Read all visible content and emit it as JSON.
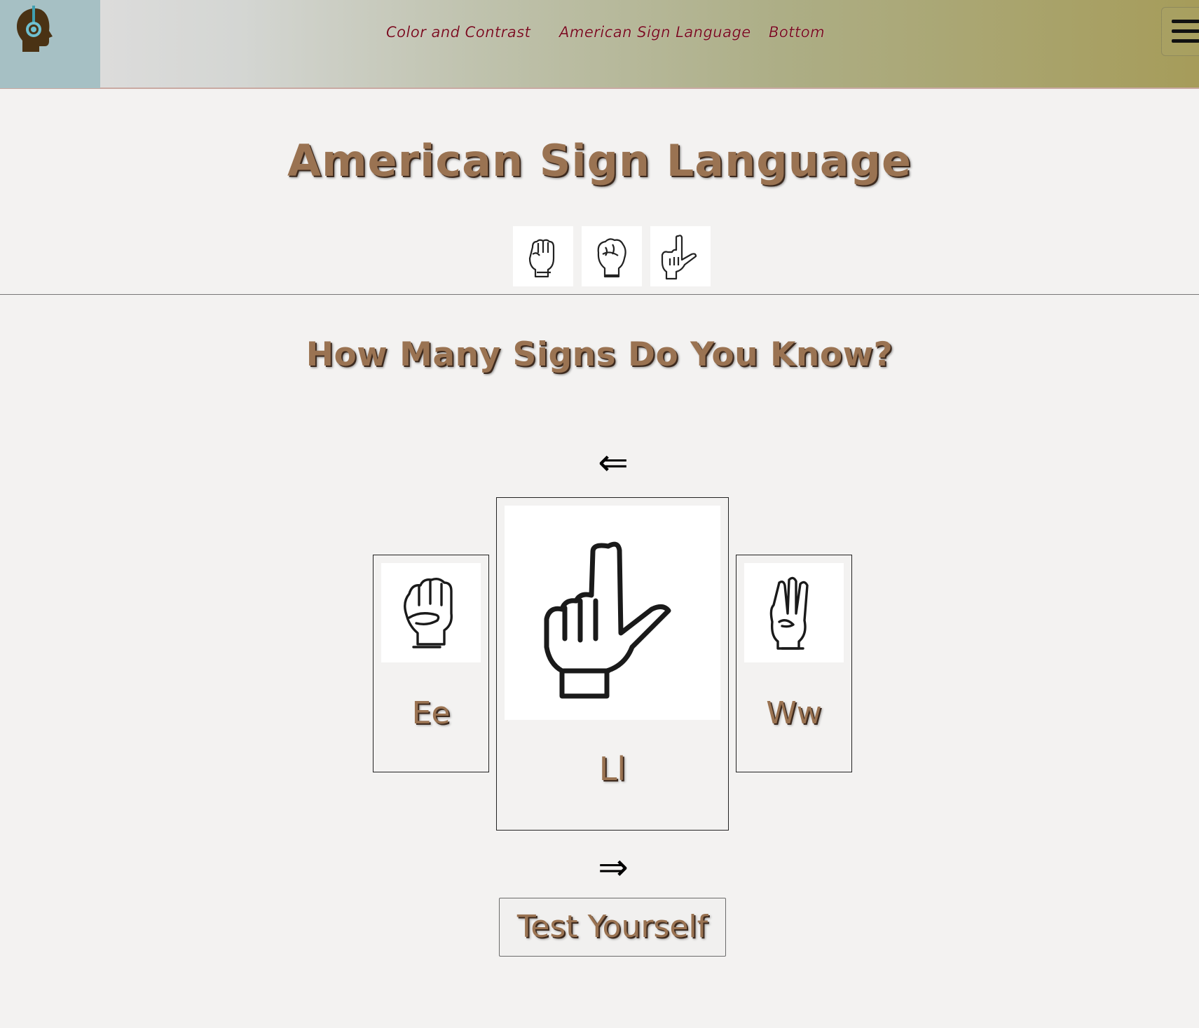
{
  "header": {
    "logo_icon": "head-headphones-icon",
    "nav": {
      "color_contrast": "Color and Contrast",
      "asl": "American Sign Language",
      "bottom": "Bottom"
    },
    "menu_icon": "hamburger-menu-icon"
  },
  "main": {
    "title": "American Sign Language",
    "title_signs": [
      "asl-hand-sign-a",
      "asl-hand-sign-s",
      "asl-hand-sign-l"
    ],
    "quiz_title": "How Many Signs Do You Know?",
    "carousel": {
      "prev_arrow": "⇐",
      "next_arrow": "⇒",
      "cards": [
        {
          "letter": "Ee",
          "icon": "asl-hand-sign-e"
        },
        {
          "letter": "Ll",
          "icon": "asl-hand-sign-l"
        },
        {
          "letter": "Ww",
          "icon": "asl-hand-sign-w"
        }
      ]
    },
    "test_button": "Test Yourself"
  },
  "colors": {
    "heading": "#9a7352",
    "heading_shadow": "#3d2a1e",
    "nav_link": "#7a1222",
    "page_bg": "#f3f2f1",
    "logo_bg": "#a6c0c4"
  }
}
